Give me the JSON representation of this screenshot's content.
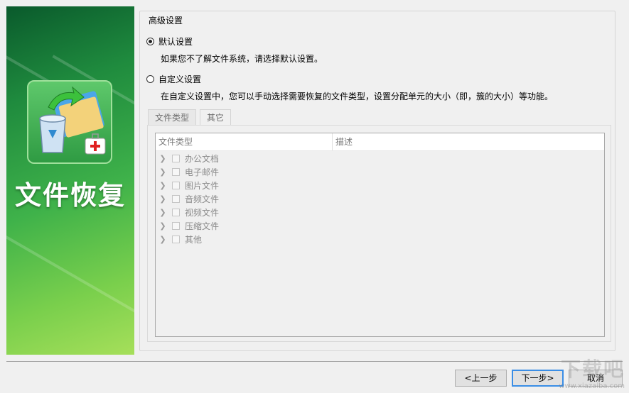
{
  "banner": {
    "title": "文件恢复",
    "colors": {
      "dark": "#0a5a2c",
      "light": "#a6df5a"
    },
    "icon": "recycle-bin-folder-medkit-icon"
  },
  "settings": {
    "group_title": "高级设置",
    "options": [
      {
        "label": "默认设置",
        "description": "如果您不了解文件系统，请选择默认设置。",
        "selected": true
      },
      {
        "label": "自定义设置",
        "description": "在自定义设置中，您可以手动选择需要恢复的文件类型，设置分配单元的大小（即，簇的大小）等功能。",
        "selected": false
      }
    ]
  },
  "tabs": [
    {
      "label": "文件类型",
      "active": true
    },
    {
      "label": "其它",
      "active": false
    }
  ],
  "file_types": {
    "columns": [
      "文件类型",
      "描述"
    ],
    "rows": [
      {
        "label": "办公文档",
        "checked": false
      },
      {
        "label": "电子邮件",
        "checked": false
      },
      {
        "label": "图片文件",
        "checked": false
      },
      {
        "label": "音频文件",
        "checked": false
      },
      {
        "label": "视频文件",
        "checked": false
      },
      {
        "label": "压缩文件",
        "checked": false
      },
      {
        "label": "其他",
        "checked": false
      }
    ]
  },
  "buttons": {
    "back": "<上一步",
    "next": "下一步>",
    "cancel": "取消"
  },
  "watermark": {
    "logo": "下载吧",
    "url": "www.xiazaiba.com"
  }
}
